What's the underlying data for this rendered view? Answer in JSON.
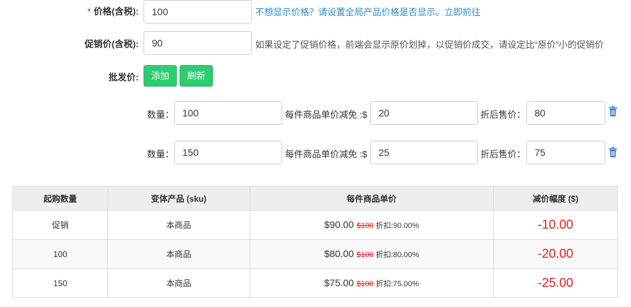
{
  "price": {
    "required_mark": "*",
    "label": "价格(含税):",
    "value": "100",
    "hint": "不想显示价格？请设置全局产品价格是否显示。立即前往"
  },
  "sale_price": {
    "label": "促销价(含税):",
    "value": "90",
    "hint": "如果设定了促销价格，前端会显示原价划掉，以促销价成交，请设定比“原价”小的促销价"
  },
  "wholesale": {
    "label": "批发价:",
    "add_label": "添加",
    "refresh_label": "刷新",
    "qty_label": "数量：",
    "reduce_label": "每件商品单价减免 :$",
    "after_label": "折后售价：",
    "tiers": [
      {
        "qty": "100",
        "reduce": "20",
        "after": "80"
      },
      {
        "qty": "150",
        "reduce": "25",
        "after": "75"
      }
    ]
  },
  "table": {
    "headers": [
      "起购数量",
      "变体产品 (sku)",
      "每件商品单价",
      "减价幅度 ($)"
    ],
    "rows": [
      {
        "qty": "促销",
        "sku": "本商品",
        "price": "$90.00",
        "old": "$100",
        "discount": "折扣:90.00%",
        "reduction": "-10.00"
      },
      {
        "qty": "100",
        "sku": "本商品",
        "price": "$80.00",
        "old": "$100",
        "discount": "折扣:80.00%",
        "reduction": "-20.00"
      },
      {
        "qty": "150",
        "sku": "本商品",
        "price": "$75.00",
        "old": "$100",
        "discount": "折扣:75.00%",
        "reduction": "-25.00"
      }
    ]
  },
  "colors": {
    "accent_green": "#2ecc71",
    "link_blue": "#2a8bc7",
    "danger_red": "#e02020",
    "icon_blue": "#3b7dd8"
  },
  "icons": {
    "delete": "trash-icon"
  }
}
